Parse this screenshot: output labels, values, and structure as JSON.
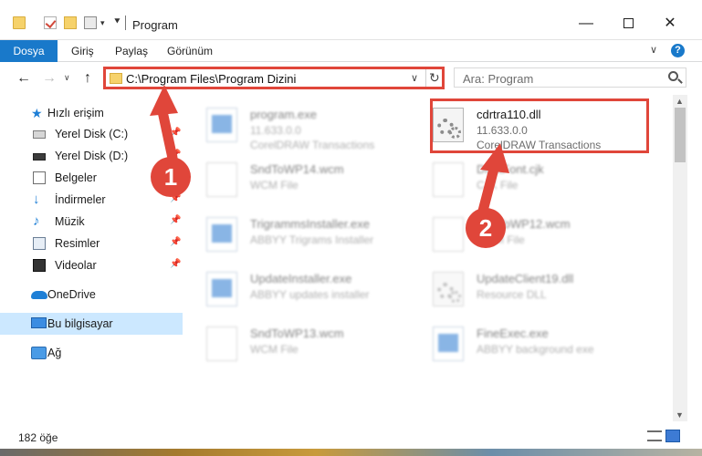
{
  "window": {
    "title": "Program",
    "minimize": "—",
    "close": "✕"
  },
  "ribbon": {
    "tabs": [
      "Dosya",
      "Giriş",
      "Paylaş",
      "Görünüm"
    ],
    "expand": "∨",
    "help": "?"
  },
  "nav": {
    "back": "←",
    "forward": "→",
    "recent": "∨",
    "up": "↑",
    "address": "C:\\Program Files\\Program Dizini",
    "address_dropdown": "∨",
    "refresh": "↻",
    "search_placeholder": "Ara: Program"
  },
  "sidebar": {
    "quick_access": "Hızlı erişim",
    "items": [
      {
        "label": "Yerel Disk (C:)",
        "icon": "drive-icon",
        "pinned": true
      },
      {
        "label": "Yerel Disk (D:)",
        "icon": "drive-icon",
        "pinned": true
      },
      {
        "label": "Belgeler",
        "icon": "documents-icon",
        "pinned": true
      },
      {
        "label": "İndirmeler",
        "icon": "downloads-icon",
        "pinned": true
      },
      {
        "label": "Müzik",
        "icon": "music-icon",
        "pinned": true
      },
      {
        "label": "Resimler",
        "icon": "pictures-icon",
        "pinned": true
      },
      {
        "label": "Videolar",
        "icon": "videos-icon",
        "pinned": true
      }
    ],
    "onedrive": "OneDrive",
    "this_pc": "Bu bilgisayar",
    "network": "Ağ"
  },
  "files": [
    {
      "name": "program.exe",
      "line1": "11.633.0.0",
      "line2": "CorelDRAW Transactions",
      "icon": "exe-icon",
      "blurred": true
    },
    {
      "name": "cdrtra110.dll",
      "line1": "11.633.0.0",
      "line2": "CorelDRAW Transactions",
      "icon": "dll-icon",
      "blurred": false
    },
    {
      "name": "SndToWP14.wcm",
      "line1": "WCM File",
      "line2": "",
      "icon": "file-icon",
      "blurred": true
    },
    {
      "name": "DraftFont.cjk",
      "line1": "CJK File",
      "line2": "",
      "icon": "file-icon",
      "blurred": true
    },
    {
      "name": "TrigrammsInstaller.exe",
      "line1": "ABBYY Trigrams Installer",
      "line2": "",
      "icon": "exe-icon",
      "blurred": true
    },
    {
      "name": "SndToWP12.wcm",
      "line1": "WCM File",
      "line2": "",
      "icon": "file-icon",
      "blurred": true
    },
    {
      "name": "UpdateInstaller.exe",
      "line1": "ABBYY updates installer",
      "line2": "",
      "icon": "exe-icon",
      "blurred": true
    },
    {
      "name": "UpdateClient19.dll",
      "line1": "Resource DLL",
      "line2": "",
      "icon": "dll-icon",
      "blurred": true
    },
    {
      "name": "SndToWP13.wcm",
      "line1": "WCM File",
      "line2": "",
      "icon": "file-icon",
      "blurred": true
    },
    {
      "name": "FineExec.exe",
      "line1": "ABBYY background exe",
      "line2": "",
      "icon": "exe-icon",
      "blurred": true
    }
  ],
  "callouts": {
    "step1": "1",
    "step2": "2",
    "color": "#e0463a"
  },
  "status": {
    "count": "182 öğe"
  },
  "colors": {
    "accent": "#1979ca",
    "selection": "#cce8ff",
    "highlight": "#e0463a"
  }
}
